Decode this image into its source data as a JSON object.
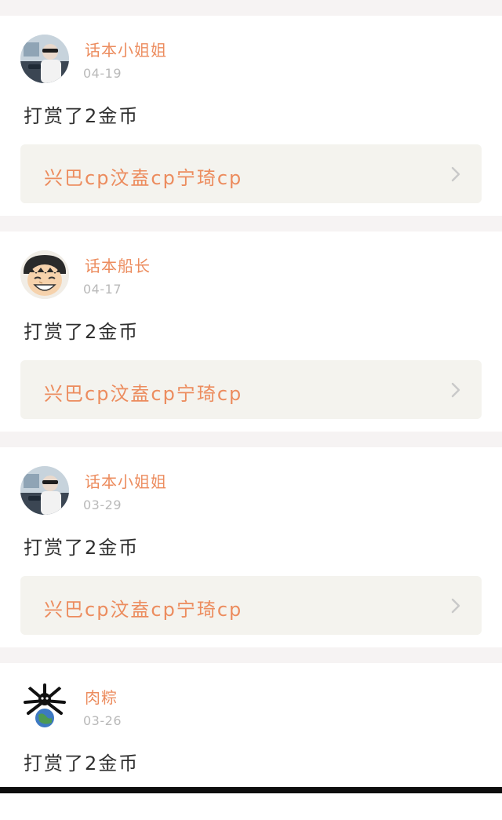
{
  "posts": [
    {
      "author": "话本小姐姐",
      "date": "04-19",
      "message": "打赏了2金币",
      "link": "兴巴cp汶盍cp宁琦cp",
      "avatar_icon": "person-car-avatar"
    },
    {
      "author": "话本船长",
      "date": "04-17",
      "message": "打赏了2金币",
      "link": "兴巴cp汶盍cp宁琦cp",
      "avatar_icon": "cartoon-boy-avatar"
    },
    {
      "author": "话本小姐姐",
      "date": "03-29",
      "message": "打赏了2金币",
      "link": "兴巴cp汶盍cp宁琦cp",
      "avatar_icon": "person-car-avatar"
    },
    {
      "author": "肉粽",
      "date": "03-26",
      "message": "打赏了2金币",
      "avatar_icon": "earth-mascot-avatar"
    }
  ],
  "colors": {
    "accent": "#ec8c5e",
    "background": "#f6f3f3",
    "card": "#ffffff",
    "link_box": "#f4f3ee",
    "date": "#b9b9b9",
    "text": "#2f2f2f"
  }
}
